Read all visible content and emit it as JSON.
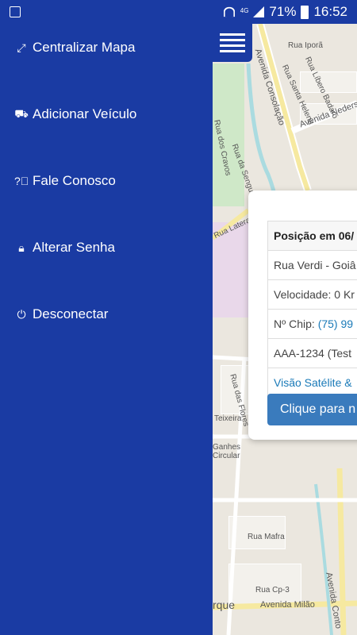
{
  "status_bar": {
    "network": "4G",
    "battery": "71%",
    "time": "16:52"
  },
  "menu": {
    "items": [
      {
        "label": "Centralizar Mapa",
        "icon": "expand-icon"
      },
      {
        "label": "Adicionar Veículo",
        "icon": "car-icon"
      },
      {
        "label": "Fale Conosco",
        "icon": "question-icon"
      },
      {
        "label": "Alterar Senha",
        "icon": "lock-icon"
      },
      {
        "label": "Desconectar",
        "icon": "power-icon"
      }
    ]
  },
  "map_labels": {
    "street1": "Avenida Consolação",
    "street2": "Rua Iporã",
    "street3": "Rua Santa Helena",
    "street4": "Rua Líbero Badaró",
    "street5": "Avenida Nederso",
    "street6": "Rua dos Cravos",
    "street7": "Rua da Sengueira",
    "street8": "Rua Lateral",
    "street9": "Rua das Flores",
    "street10": "Teixeira",
    "street11": "Ganhes Circular",
    "street12": "Rua Mafra",
    "street13": "Rua Cp-3",
    "street14": "Avenida Milão",
    "street15": "Avenida Conto",
    "street16": "rque"
  },
  "popup": {
    "title": "Posição em 06/",
    "address": "Rua Verdi - Goiâ",
    "speed_label": "Velocidade:",
    "speed_value": "0 Kr",
    "chip_label": "Nº Chip:",
    "chip_value": "(75) 99",
    "plate": "AAA-1234 (Test",
    "satellite_link": "Visão Satélite &",
    "button": "Clique para n"
  }
}
